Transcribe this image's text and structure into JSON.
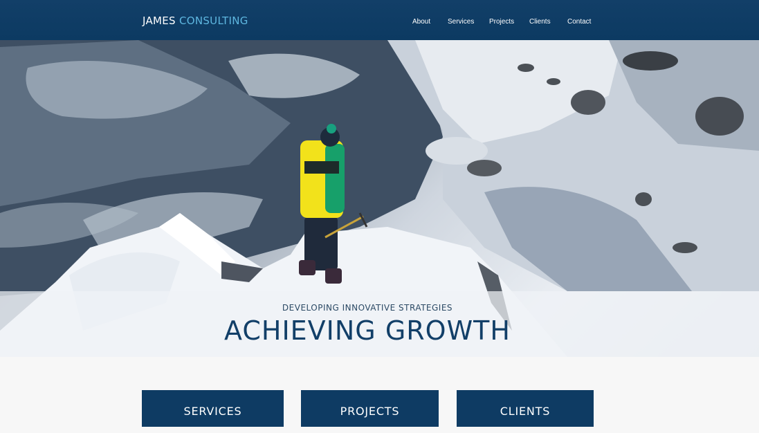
{
  "header": {
    "brand_main": "JAMES ",
    "brand_accent": "CONSULTING",
    "nav": [
      "About",
      "Services",
      "Projects",
      "Clients",
      "Contact"
    ]
  },
  "hero": {
    "subtitle": "DEVELOPING INNOVATIVE STRATEGIES",
    "title": "ACHIEVING GROWTH"
  },
  "cards": [
    "SERVICES",
    "PROJECTS",
    "CLIENTS"
  ],
  "colors": {
    "header_bg": "#0c3a62",
    "brand_accent": "#5eb7e0",
    "card_bg": "#0e3b63",
    "title_text": "#123f68"
  }
}
